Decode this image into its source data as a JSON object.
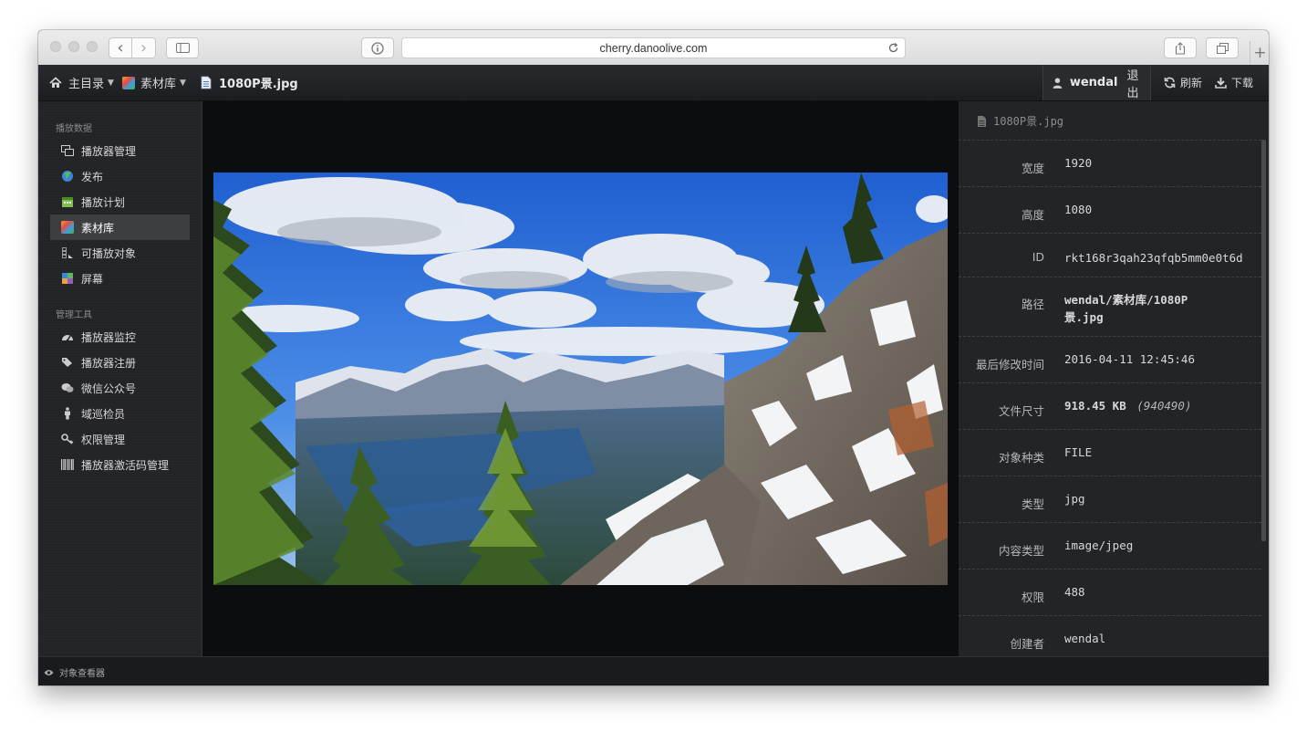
{
  "browser": {
    "url": "cherry.danoolive.com",
    "back_glyph": "‹",
    "forward_glyph": "›",
    "new_tab_glyph": "+"
  },
  "topnav": {
    "home_label": "主目录",
    "library_label": "素材库",
    "file_label": "1080P景.jpg",
    "username": "wendal",
    "logout_label": "退出",
    "refresh_label": "刷新",
    "download_label": "下载"
  },
  "sidebar": {
    "section1_title": "播放数据",
    "section1_items": [
      {
        "label": "播放器管理",
        "icon": "monitor-icon"
      },
      {
        "label": "发布",
        "icon": "globe-icon"
      },
      {
        "label": "播放计划",
        "icon": "calendar-icon"
      },
      {
        "label": "素材库",
        "icon": "library-icon",
        "active": true
      },
      {
        "label": "可播放对象",
        "icon": "film-icon"
      },
      {
        "label": "屏幕",
        "icon": "screen-icon"
      }
    ],
    "section2_title": "管理工具",
    "section2_items": [
      {
        "label": "播放器监控",
        "icon": "dashboard-icon"
      },
      {
        "label": "播放器注册",
        "icon": "tags-icon"
      },
      {
        "label": "微信公众号",
        "icon": "wechat-icon"
      },
      {
        "label": "域巡检员",
        "icon": "person-icon"
      },
      {
        "label": "权限管理",
        "icon": "key-icon"
      },
      {
        "label": "播放器激活码管理",
        "icon": "barcode-icon"
      }
    ]
  },
  "info": {
    "title": "1080P景.jpg",
    "rows": [
      {
        "label": "宽度",
        "value": "1920"
      },
      {
        "label": "高度",
        "value": "1080"
      },
      {
        "label": "ID",
        "value": "rkt168r3qah23qfqb5mm0e0t6d"
      },
      {
        "label": "路径",
        "value_line1": "wendal/素材库/1080P",
        "value_line2": "景.jpg"
      },
      {
        "label": "最后修改时间",
        "value": "2016-04-11 12:45:46"
      },
      {
        "label": "文件尺寸",
        "value": "918.45 KB",
        "value_extra": "(940490)"
      },
      {
        "label": "对象种类",
        "value": "FILE"
      },
      {
        "label": "类型",
        "value": "jpg"
      },
      {
        "label": "内容类型",
        "value": "image/jpeg"
      },
      {
        "label": "权限",
        "value": "488"
      },
      {
        "label": "创建者",
        "value": "wendal"
      }
    ]
  },
  "footer": {
    "label": "对象查看器"
  }
}
